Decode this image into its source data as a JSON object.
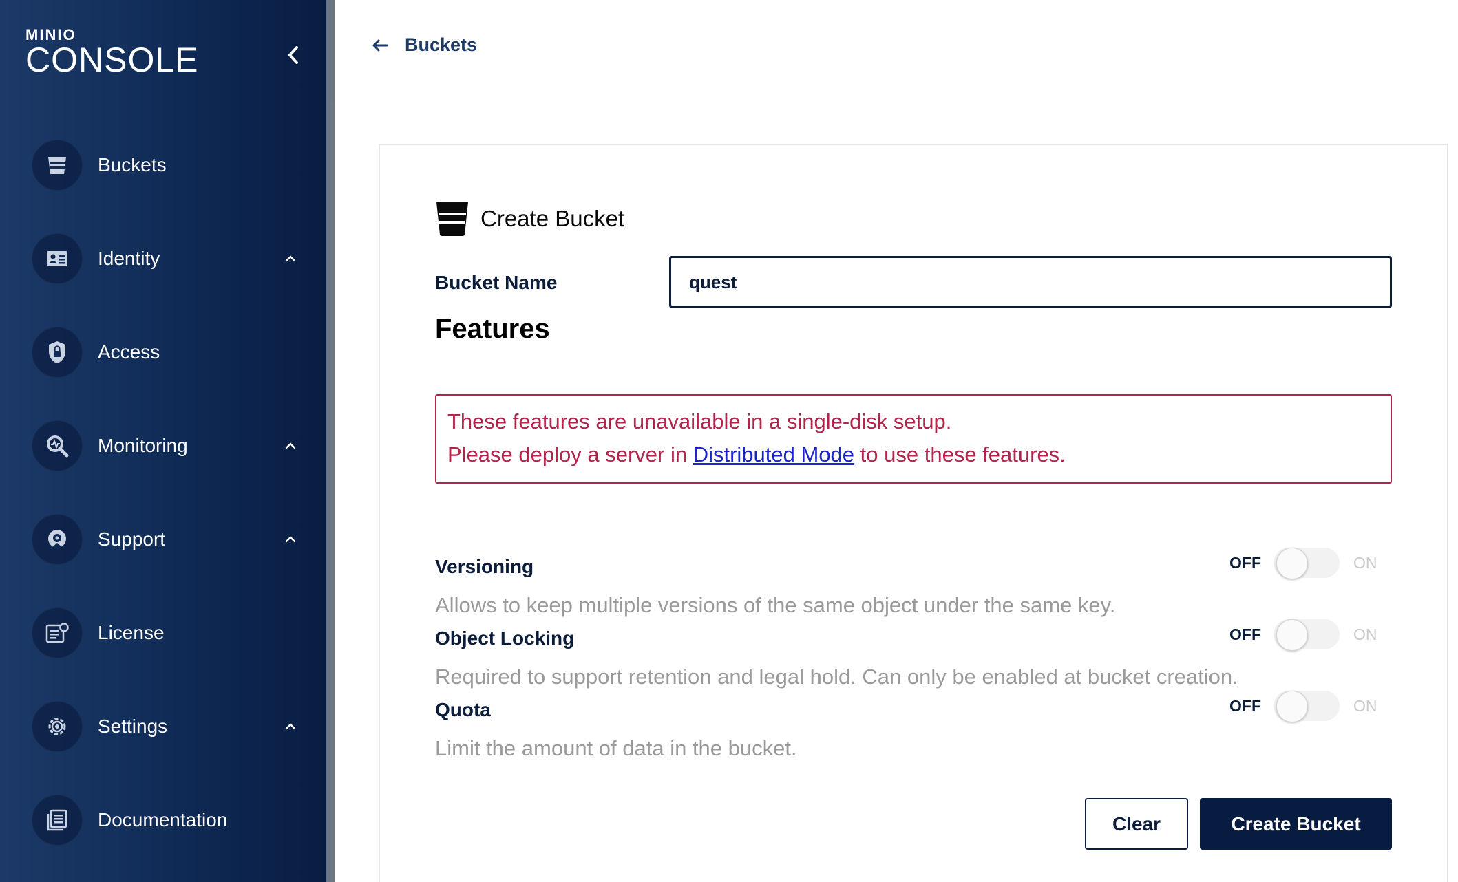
{
  "sidebar": {
    "logo_small": "MINIO",
    "logo_big": "CONSOLE",
    "items": [
      {
        "label": "Buckets",
        "icon": "bucket-icon",
        "expandable": false
      },
      {
        "label": "Identity",
        "icon": "identity-card-icon",
        "expandable": true
      },
      {
        "label": "Access",
        "icon": "lock-icon",
        "expandable": false
      },
      {
        "label": "Monitoring",
        "icon": "monitoring-icon",
        "expandable": true
      },
      {
        "label": "Support",
        "icon": "support-icon",
        "expandable": true
      },
      {
        "label": "License",
        "icon": "license-icon",
        "expandable": false
      },
      {
        "label": "Settings",
        "icon": "gear-icon",
        "expandable": true
      },
      {
        "label": "Documentation",
        "icon": "documentation-icon",
        "expandable": false
      }
    ]
  },
  "header": {
    "back_label": "Buckets"
  },
  "form": {
    "title": "Create Bucket",
    "bucket_name_label": "Bucket Name",
    "bucket_name_value": "quest",
    "features_title": "Features",
    "error": {
      "line1": "These features are unavailable in a single-disk setup.",
      "line2_prefix": "Please deploy a server in ",
      "line2_link": "Distributed Mode",
      "line2_suffix": " to use these features."
    },
    "features": [
      {
        "name": "Versioning",
        "description": "Allows to keep multiple versions of the same object under the same key.",
        "state": "OFF"
      },
      {
        "name": "Object Locking",
        "description": "Required to support retention and legal hold. Can only be enabled at bucket creation.",
        "state": "OFF"
      },
      {
        "name": "Quota",
        "description": "Limit the amount of data in the bucket.",
        "state": "OFF"
      }
    ],
    "toggle_off_label": "OFF",
    "toggle_on_label": "ON",
    "clear_label": "Clear",
    "create_label": "Create Bucket"
  },
  "colors": {
    "sidebar_bg": "#0f2a55",
    "primary": "#081c42",
    "error": "#b3244a",
    "link": "#1a24c8"
  }
}
